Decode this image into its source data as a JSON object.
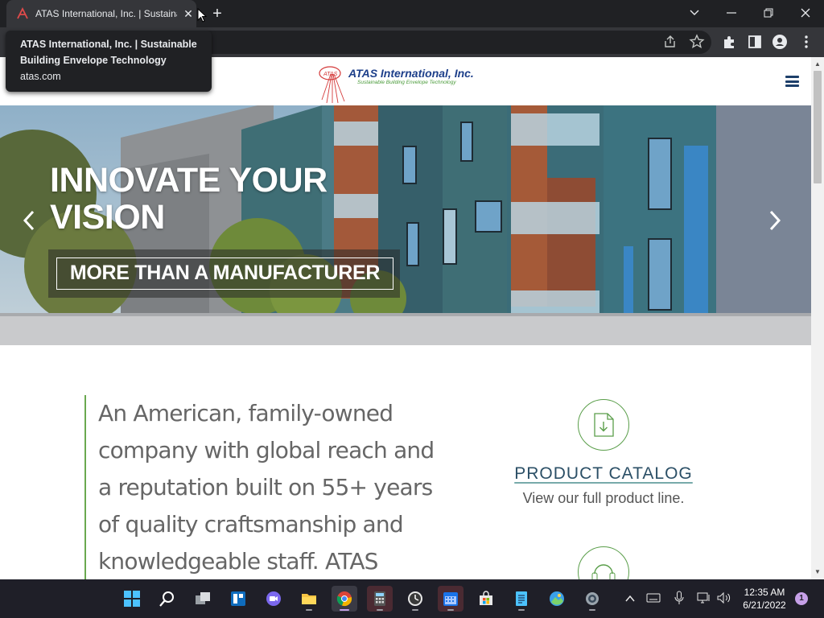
{
  "browser": {
    "tab_title": "ATAS International, Inc. | Sustaina",
    "tab_close": "✕",
    "new_tab": "+",
    "tooltip": {
      "title": "ATAS International, Inc. | Sustainable Building Envelope Technology",
      "url": "atas.com"
    },
    "window_controls": [
      "minimize",
      "restore",
      "close"
    ]
  },
  "site": {
    "logo_name": "ATAS International, Inc.",
    "logo_tagline": "Sustainable Building Envelope Technology",
    "logo_mark": "ATAS",
    "hero": {
      "headline_line1": "INNOVATE YOUR",
      "headline_line2": "VISION",
      "subheadline": "MORE THAN A MANUFACTURER",
      "prev": "‹",
      "next": "›"
    },
    "intro_lines": [
      "An American, family-owned",
      "company with global reach and",
      "a reputation built on 55+ years",
      "of quality craftsmanship and",
      "knowledgeable staff. ATAS"
    ],
    "catalog": {
      "title": "PRODUCT CATALOG",
      "description": "View our full product line."
    }
  },
  "taskbar": {
    "apps": [
      "start-icon",
      "search-icon",
      "task-view-icon",
      "widgets-icon",
      "chat-icon",
      "file-explorer-icon",
      "chrome-icon",
      "calculator-icon",
      "clock-icon",
      "calendar-icon",
      "store-icon",
      "notepad-icon",
      "photos-icon",
      "settings-icon"
    ],
    "clock_time": "12:35 AM",
    "clock_date": "6/21/2022",
    "notification_count": "1"
  },
  "colors": {
    "brand_blue": "#1d3f8a",
    "brand_green": "#5a9e4a",
    "chrome_dark": "#202124"
  }
}
